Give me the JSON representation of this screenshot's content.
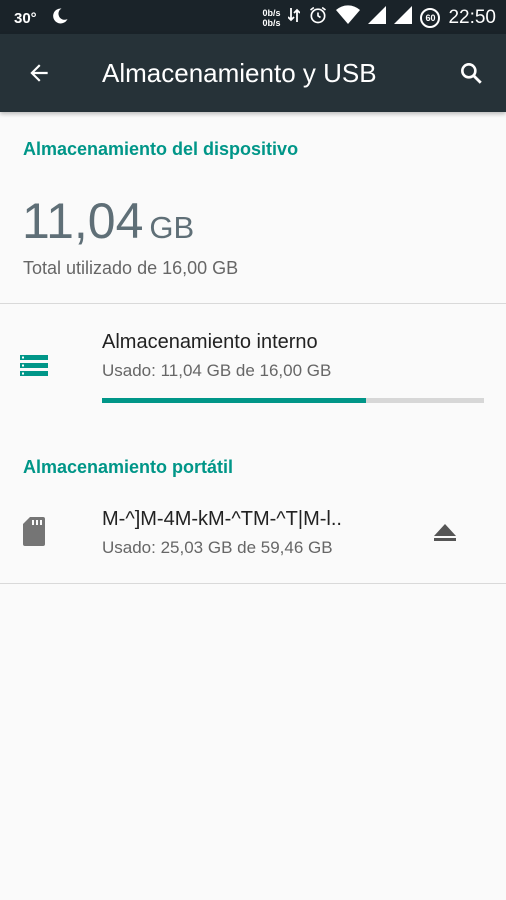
{
  "status_bar": {
    "temperature": "30°",
    "net_up": "0b/s",
    "net_down": "0b/s",
    "battery": "60",
    "time": "22:50"
  },
  "app_bar": {
    "title": "Almacenamiento y USB",
    "back_icon": "arrow-back-icon",
    "search_icon": "search-icon"
  },
  "device_storage": {
    "header": "Almacenamiento del dispositivo",
    "used_value": "11,04",
    "used_unit": "GB",
    "total_text": "Total utilizado de 16,00 GB"
  },
  "internal_storage": {
    "icon": "storage-icon",
    "title": "Almacenamiento interno",
    "subtitle": "Usado: 11,04 GB de 16,00 GB",
    "used_fraction": 0.69
  },
  "portable_storage": {
    "header": "Almacenamiento portátil",
    "icon": "sd-card-icon",
    "title": "M-^]M-4M-kM-^TM-^T|M-l..",
    "subtitle": "Usado: 25,03 GB de 59,46 GB",
    "eject_icon": "eject-icon"
  },
  "colors": {
    "accent": "#009688",
    "app_bar": "#263238",
    "status_bar": "#1a2329"
  }
}
